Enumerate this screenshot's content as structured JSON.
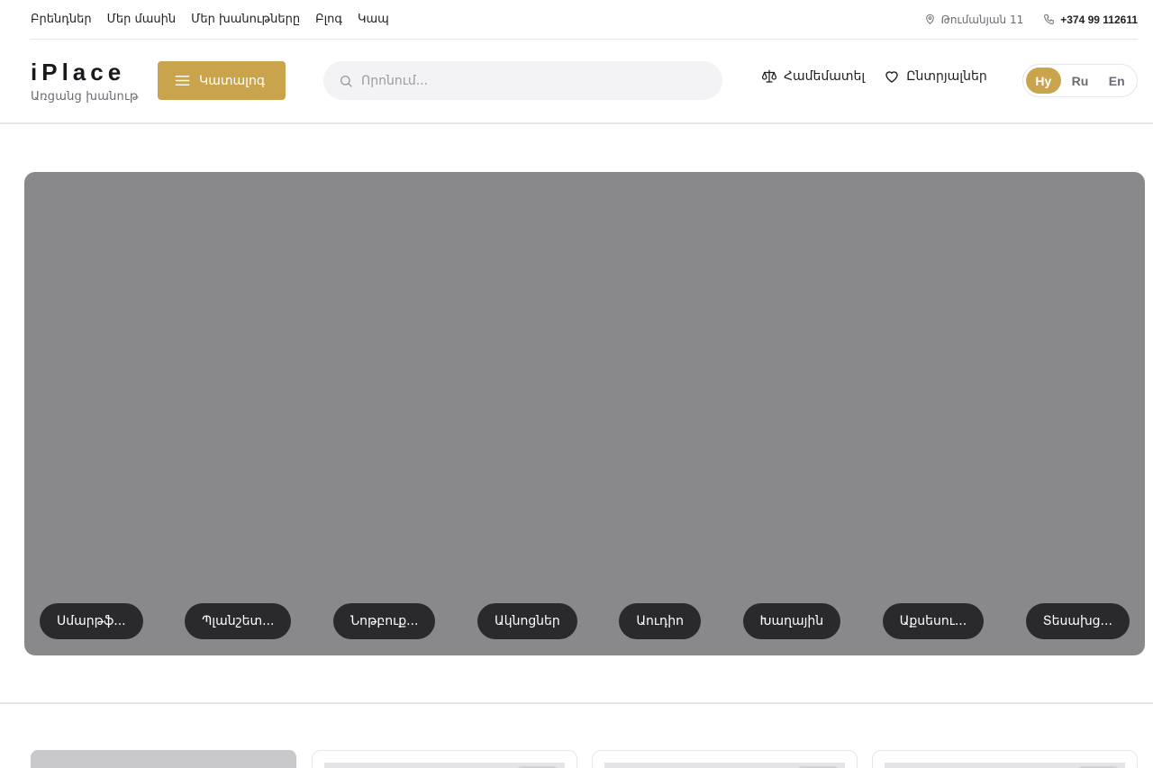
{
  "topbar": {
    "nav": [
      "Բրենդներ",
      "Մեր մասին",
      "Մեր խանութները",
      "Բլոգ",
      "Կապ"
    ],
    "address": "Թումանյան 11",
    "phone": "+374 99 112611",
    "icons": {
      "address": "location-icon",
      "phone": "phone-icon"
    }
  },
  "header": {
    "logo_title": "iPlace",
    "logo_subtitle": "Առցանց խանութ",
    "catalog_label": "Կատալոգ",
    "search_placeholder": "Որոնում...",
    "compare_label": "Համեմատել",
    "favorites_label": "Ընտրյալներ",
    "languages": [
      "Hy",
      "Ru",
      "En"
    ],
    "active_language": "Hy"
  },
  "hero": {
    "categories": [
      "Սմարթֆ...",
      "Պլանշետ...",
      "Նոթբուք...",
      "Ակնոցներ",
      "Աուդիո",
      "Խաղային",
      "Աքսեսու...",
      "Տեսախց..."
    ]
  },
  "colors": {
    "accent": "#c9a44c",
    "hero_bg": "#89898b",
    "chip_bg": "#2a2a2c"
  }
}
